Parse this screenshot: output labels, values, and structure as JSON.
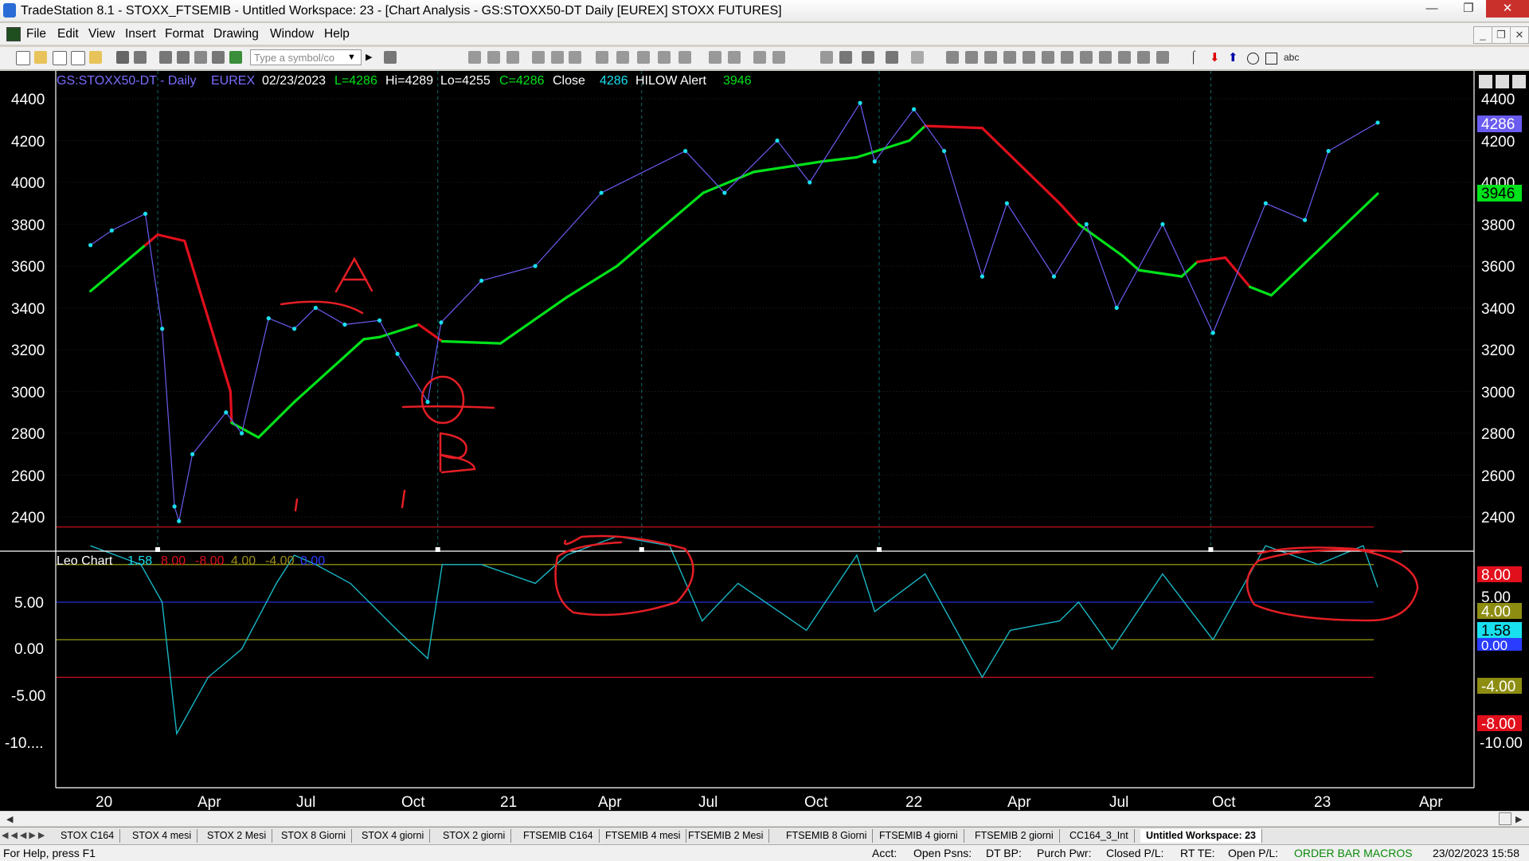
{
  "window": {
    "title": "TradeStation 8.1 - STOXX_FTSEMIB - Untitled Workspace:  23 - [Chart Analysis - GS:STOXX50-DT  Daily  [EUREX] STOXX FUTURES]"
  },
  "menu": [
    "File",
    "Edit",
    "View",
    "Insert",
    "Format",
    "Drawing",
    "Window",
    "Help"
  ],
  "toolbar": {
    "symbol_placeholder": "Type a symbol/co",
    "text_tool": "abc"
  },
  "colors": {
    "accent": "#19e0ee",
    "up_line": "#00e21a",
    "down_line": "#e10f1c"
  },
  "price_header": {
    "symbol": "GS:STOXX50-DT - Daily",
    "exchange": "EUREX",
    "date": "02/23/2023",
    "low_label": "L=4286",
    "high_label": "Hi=4289",
    "lo_label": "Lo=4255",
    "close_label": "C=4286",
    "close_text": "Close",
    "close_value": "4286",
    "indicator": "HILOW Alert",
    "indicator_value": "3946"
  },
  "osc_header": {
    "name": "Leo Chart",
    "v1": "1.58",
    "v2": "8.00",
    "v3": "-8.00",
    "v4": "4.00",
    "v5": "-4.00",
    "v6": "0.00"
  },
  "price_axis": {
    "ticks": [
      "4400",
      "4200",
      "4000",
      "3800",
      "3600",
      "3400",
      "3200",
      "3000",
      "2800",
      "2600",
      "2400"
    ]
  },
  "price_badges": {
    "close": "4286",
    "hilow": "3946"
  },
  "osc_axis": {
    "ticks": [
      "5.00",
      "0.00",
      "-5.00",
      "-10...."
    ]
  },
  "osc_badges": {
    "b8": "8.00",
    "b4": "4.00",
    "b158": "1.58",
    "b0": "0.00",
    "bm4": "-4.00",
    "bm8": "-8.00",
    "bm10": "-10.00"
  },
  "time_axis": {
    "labels": [
      "20",
      "Apr",
      "Jul",
      "Oct",
      "21",
      "Apr",
      "Jul",
      "Oct",
      "22",
      "Apr",
      "Jul",
      "Oct",
      "23",
      "Apr"
    ]
  },
  "annotations": {
    "a": "A",
    "b": "B"
  },
  "chart_data": [
    {
      "type": "line",
      "title": "GS:STOXX50-DT - Daily",
      "y_ticks": [
        4400,
        4200,
        4000,
        3800,
        3600,
        3400,
        3200,
        3000,
        2800,
        2600,
        2400
      ],
      "ylim": [
        2330,
        4460
      ],
      "x_labels": [
        "20",
        "Apr",
        "Jul",
        "Oct",
        "21",
        "Apr",
        "Jul",
        "Oct",
        "22",
        "Apr",
        "Jul",
        "Oct",
        "23",
        "Apr"
      ],
      "series": [
        {
          "name": "Close",
          "points": [
            [
              "2020-01-01",
              3700
            ],
            [
              "2020-01-20",
              3770
            ],
            [
              "2020-02-19",
              3850
            ],
            [
              "2020-03-05",
              3300
            ],
            [
              "2020-03-16",
              2450
            ],
            [
              "2020-03-20",
              2380
            ],
            [
              "2020-04-01",
              2700
            ],
            [
              "2020-05-01",
              2900
            ],
            [
              "2020-05-15",
              2800
            ],
            [
              "2020-06-08",
              3350
            ],
            [
              "2020-07-01",
              3300
            ],
            [
              "2020-07-20",
              3400
            ],
            [
              "2020-08-15",
              3320
            ],
            [
              "2020-09-15",
              3340
            ],
            [
              "2020-10-01",
              3180
            ],
            [
              "2020-10-28",
              2950
            ],
            [
              "2020-11-09",
              3330
            ],
            [
              "2020-12-15",
              3530
            ],
            [
              "2021-02-01",
              3600
            ],
            [
              "2021-04-01",
              3950
            ],
            [
              "2021-06-15",
              4150
            ],
            [
              "2021-07-20",
              3950
            ],
            [
              "2021-09-05",
              4200
            ],
            [
              "2021-10-04",
              4000
            ],
            [
              "2021-11-18",
              4380
            ],
            [
              "2021-12-01",
              4100
            ],
            [
              "2022-01-05",
              4350
            ],
            [
              "2022-02-01",
              4150
            ],
            [
              "2022-03-07",
              3550
            ],
            [
              "2022-03-29",
              3900
            ],
            [
              "2022-05-10",
              3550
            ],
            [
              "2022-06-08",
              3800
            ],
            [
              "2022-07-05",
              3400
            ],
            [
              "2022-08-15",
              3800
            ],
            [
              "2022-09-29",
              3280
            ],
            [
              "2022-11-15",
              3900
            ],
            [
              "2022-12-20",
              3820
            ],
            [
              "2023-01-10",
              4150
            ],
            [
              "2023-02-23",
              4286
            ]
          ]
        },
        {
          "name": "HILOW Alert",
          "points": [
            [
              "2020-01-01",
              3480
            ],
            [
              "2020-02-19",
              3700
            ],
            [
              "2020-03-01",
              3750
            ],
            [
              "2020-03-25",
              3720
            ],
            [
              "2020-05-05",
              3000
            ],
            [
              "2020-05-06",
              2850
            ],
            [
              "2020-05-30",
              2780
            ],
            [
              "2020-07-01",
              2950
            ],
            [
              "2020-09-01",
              3250
            ],
            [
              "2020-09-15",
              3260
            ],
            [
              "2020-10-20",
              3320
            ],
            [
              "2020-11-10",
              3240
            ],
            [
              "2021-01-01",
              3230
            ],
            [
              "2021-03-01",
              3450
            ],
            [
              "2021-04-15",
              3600
            ],
            [
              "2021-07-01",
              3950
            ],
            [
              "2021-08-15",
              4050
            ],
            [
              "2021-10-15",
              4100
            ],
            [
              "2021-11-15",
              4120
            ],
            [
              "2022-01-01",
              4200
            ],
            [
              "2022-01-15",
              4270
            ],
            [
              "2022-03-07",
              4260
            ],
            [
              "2022-05-15",
              3900
            ],
            [
              "2022-06-01",
              3800
            ],
            [
              "2022-07-10",
              3650
            ],
            [
              "2022-07-25",
              3580
            ],
            [
              "2022-09-01",
              3550
            ],
            [
              "2022-09-15",
              3620
            ],
            [
              "2022-10-10",
              3640
            ],
            [
              "2022-11-01",
              3500
            ],
            [
              "2022-11-20",
              3460
            ],
            [
              "2023-02-23",
              3946
            ]
          ]
        }
      ]
    },
    {
      "type": "line",
      "title": "Leo Chart",
      "y_ticks": [
        5,
        0,
        -5,
        -10
      ],
      "ylim": [
        -14.5,
        10
      ],
      "levels": [
        8,
        4,
        0,
        -4,
        -8
      ],
      "series": [
        {
          "name": "Leo Chart",
          "points": [
            [
              "2020-01-01",
              6
            ],
            [
              "2020-02-15",
              4
            ],
            [
              "2020-03-05",
              0
            ],
            [
              "2020-03-18",
              -14
            ],
            [
              "2020-04-15",
              -8
            ],
            [
              "2020-05-15",
              -5
            ],
            [
              "2020-06-15",
              2
            ],
            [
              "2020-07-01",
              5
            ],
            [
              "2020-07-20",
              4
            ],
            [
              "2020-08-20",
              2
            ],
            [
              "2020-10-01",
              -3
            ],
            [
              "2020-10-28",
              -6
            ],
            [
              "2020-11-10",
              4
            ],
            [
              "2020-12-15",
              4
            ],
            [
              "2021-02-01",
              2
            ],
            [
              "2021-03-01",
              5
            ],
            [
              "2021-04-15",
              7
            ],
            [
              "2021-06-01",
              6
            ],
            [
              "2021-06-30",
              -2
            ],
            [
              "2021-08-01",
              2
            ],
            [
              "2021-10-01",
              -3
            ],
            [
              "2021-11-15",
              5
            ],
            [
              "2021-12-01",
              -1
            ],
            [
              "2022-01-15",
              3
            ],
            [
              "2022-03-07",
              -8
            ],
            [
              "2022-04-01",
              -3
            ],
            [
              "2022-05-15",
              -2
            ],
            [
              "2022-06-01",
              0
            ],
            [
              "2022-07-01",
              -5
            ],
            [
              "2022-08-15",
              3
            ],
            [
              "2022-09-29",
              -4
            ],
            [
              "2022-11-15",
              6
            ],
            [
              "2023-01-01",
              4
            ],
            [
              "2023-02-10",
              6
            ],
            [
              "2023-02-23",
              1.58
            ]
          ]
        }
      ]
    }
  ]
}
